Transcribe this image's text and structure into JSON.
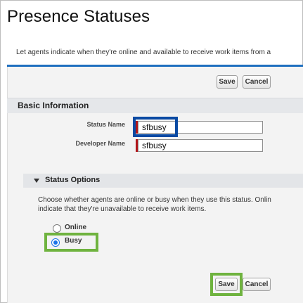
{
  "page": {
    "title": "Presence Statuses",
    "description": "Let agents indicate when they're online and available to receive work items from a"
  },
  "toolbar": {
    "save_label": "Save",
    "cancel_label": "Cancel"
  },
  "basic_information": {
    "header": "Basic Information",
    "status_name_label": "Status Name",
    "status_name_value": "sfbusy",
    "developer_name_label": "Developer Name",
    "developer_name_value": "sfbusy"
  },
  "status_options": {
    "header": "Status Options",
    "help_line_1": "Choose whether agents are online or busy when they use this status. Onlin",
    "help_line_2": "indicate that they're unavailable to receive work items.",
    "options": [
      {
        "label": "Online",
        "selected": false
      },
      {
        "label": "Busy",
        "selected": true
      }
    ]
  },
  "highlight_colors": {
    "blue": "#0b4aa3",
    "green": "#6fb33f"
  }
}
